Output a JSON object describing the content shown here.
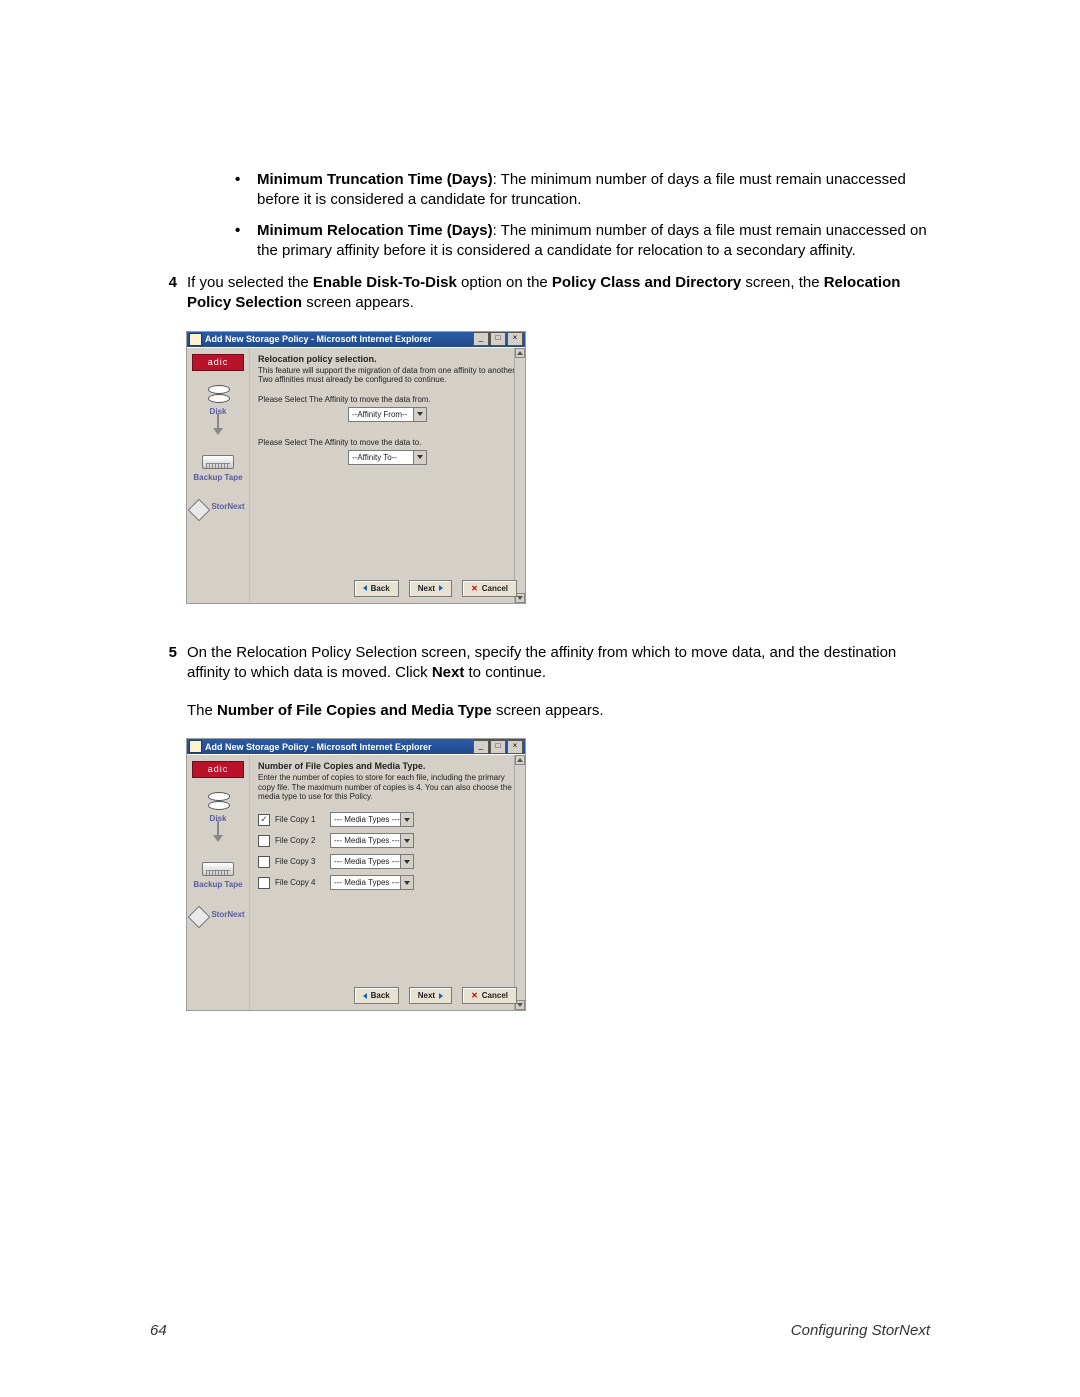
{
  "bullets": [
    {
      "term": "Minimum Truncation Time (Days)",
      "text": ": The minimum number of days a file must remain unaccessed before it is considered a candidate for truncation."
    },
    {
      "term": "Minimum Relocation Time (Days)",
      "text": ": The minimum number of days a file must remain unaccessed on the primary affinity before it is considered a candidate for relocation to a secondary affinity."
    }
  ],
  "step4": {
    "num": "4",
    "pre": "If you selected the ",
    "b1": "Enable Disk-To-Disk",
    "mid": " option on the ",
    "b2": "Policy Class and Directory",
    "post": " screen, the ",
    "b3": "Relocation Policy Selection",
    "tail": " screen appears."
  },
  "window_common": {
    "title": "Add New Storage Policy - Microsoft Internet Explorer",
    "logo_text": "adic",
    "sidebar": {
      "disk": "Disk",
      "tape": "Backup Tape",
      "stornext": "StorNext"
    },
    "buttons": {
      "back": "Back",
      "next": "Next",
      "cancel": "Cancel"
    }
  },
  "screen1": {
    "heading": "Relocation policy selection.",
    "desc": "This feature will support the migration of data from one affinity to another. Two affinities must already be configured to continue.",
    "label_from": "Please Select The Affinity to move the data from.",
    "dd_from": "--Affinity From--",
    "label_to": "Please Select The Affinity to move the data to.",
    "dd_to": "--Affinity To--"
  },
  "step5": {
    "num": "5",
    "pre": "On the Relocation Policy Selection screen, specify the affinity from which to move data, and the destination affinity to which data is moved. Click ",
    "b1": "Next",
    "post": " to continue."
  },
  "para2": {
    "pre": "The ",
    "b1": "Number of File Copies and Media Type",
    "post": " screen appears."
  },
  "screen2": {
    "heading": "Number of File Copies and Media Type.",
    "desc": "Enter the number of copies to store for each file, including the primary copy file. The maximum number of copies is 4. You can also choose the media type to use for this Policy.",
    "dd_media": "--- Media Types ---",
    "copies": [
      {
        "label": "File Copy 1",
        "checked": true
      },
      {
        "label": "File Copy 2",
        "checked": false
      },
      {
        "label": "File Copy 3",
        "checked": false
      },
      {
        "label": "File Copy 4",
        "checked": false
      }
    ]
  },
  "footer": {
    "page": "64",
    "section": "Configuring StorNext"
  }
}
